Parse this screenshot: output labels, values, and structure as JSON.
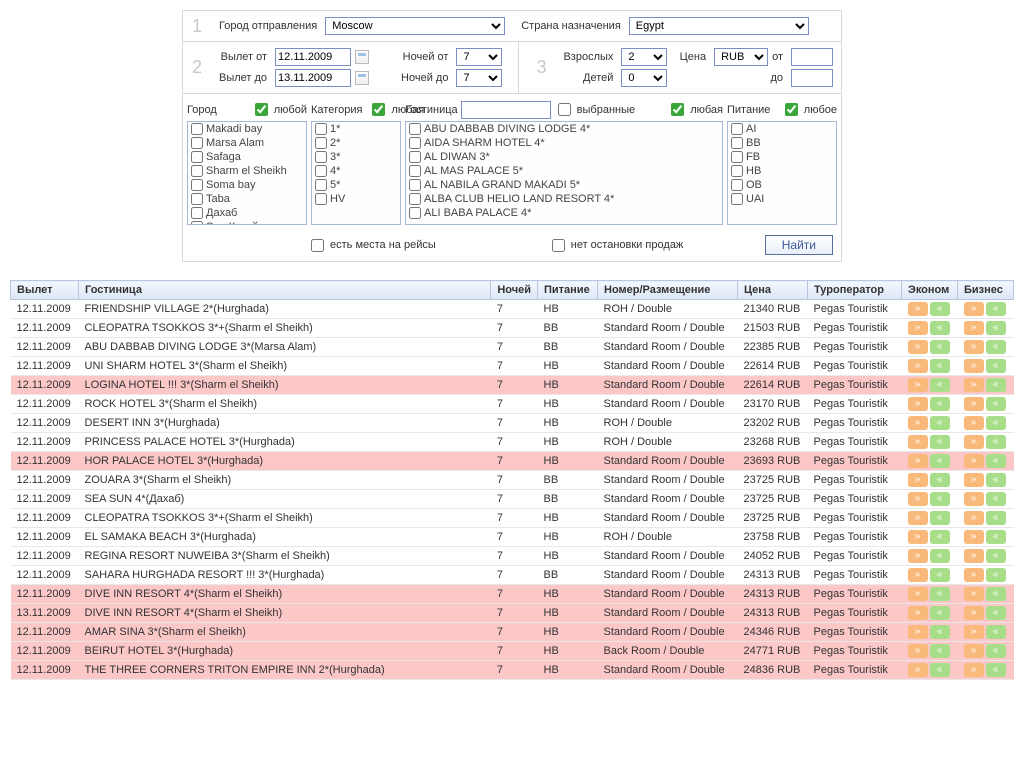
{
  "step1": {
    "num": "1",
    "label_city": "Город отправления",
    "city": "Moscow",
    "label_country": "Страна назначения",
    "country": "Egypt"
  },
  "step2": {
    "num": "2",
    "label_dep_from": "Вылет от",
    "dep_from": "12.11.2009",
    "label_dep_to": "Вылет до",
    "dep_to": "13.11.2009",
    "label_nights_from": "Ночей от",
    "nights_from": "7",
    "label_nights_to": "Ночей до",
    "nights_to": "7"
  },
  "step3": {
    "num": "3",
    "label_adults": "Взрослых",
    "adults": "2",
    "label_children": "Детей",
    "children": "0",
    "label_price": "Цена",
    "currency": "RUB",
    "label_from": "от",
    "label_to": "до"
  },
  "filters": {
    "city": {
      "label": "Город",
      "any": "любой",
      "items": [
        "Makadi bay",
        "Marsa Alam",
        "Safaga",
        "Sharm el Sheikh",
        "Soma bay",
        "Taba",
        "Дахаб",
        "Эль Кусейр"
      ]
    },
    "category": {
      "label": "Категория",
      "any": "любая",
      "items": [
        "1*",
        "2*",
        "3*",
        "4*",
        "5*",
        "HV"
      ]
    },
    "hotel": {
      "label": "Гостиница",
      "selected": "выбранные",
      "any": "любая",
      "items": [
        "ABU DABBAB DIVING LODGE 4*",
        "AIDA SHARM HOTEL 4*",
        "AL DIWAN 3*",
        "AL MAS PALACE 5*",
        "AL NABILA GRAND MAKADI 5*",
        "ALBA CLUB HELIO LAND RESORT 4*",
        "ALI BABA PALACE 4*"
      ]
    },
    "meal": {
      "label": "Питание",
      "any": "любое",
      "items": [
        "AI",
        "BB",
        "FB",
        "HB",
        "OB",
        "UAI"
      ]
    }
  },
  "bottom": {
    "seats": "есть места на рейсы",
    "stops": "нет остановки продаж",
    "find": "Найти"
  },
  "columns": {
    "dep": "Вылет",
    "hotel": "Гостиница",
    "nights": "Ночей",
    "meal": "Питание",
    "room": "Номер/Размещение",
    "price": "Цена",
    "operator": "Туроператор",
    "econom": "Эконом",
    "business": "Бизнес"
  },
  "rows": [
    {
      "d": "12.11.2009",
      "h": "FRIENDSHIP VILLAGE 2*(Hurghada)",
      "n": "7",
      "m": "HB",
      "r": "ROH / Double",
      "p": "21340 RUB",
      "o": "Pegas Touristik",
      "hl": false
    },
    {
      "d": "12.11.2009",
      "h": "CLEOPATRA TSOKKOS 3*+(Sharm el Sheikh)",
      "n": "7",
      "m": "BB",
      "r": "Standard Room / Double",
      "p": "21503 RUB",
      "o": "Pegas Touristik",
      "hl": false
    },
    {
      "d": "12.11.2009",
      "h": "ABU DABBAB DIVING LODGE 3*(Marsa Alam)",
      "n": "7",
      "m": "BB",
      "r": "Standard Room / Double",
      "p": "22385 RUB",
      "o": "Pegas Touristik",
      "hl": false
    },
    {
      "d": "12.11.2009",
      "h": "UNI SHARM HOTEL 3*(Sharm el Sheikh)",
      "n": "7",
      "m": "HB",
      "r": "Standard Room / Double",
      "p": "22614 RUB",
      "o": "Pegas Touristik",
      "hl": false
    },
    {
      "d": "12.11.2009",
      "h": "LOGINA HOTEL !!! 3*(Sharm el Sheikh)",
      "n": "7",
      "m": "HB",
      "r": "Standard Room / Double",
      "p": "22614 RUB",
      "o": "Pegas Touristik",
      "hl": true
    },
    {
      "d": "12.11.2009",
      "h": "ROCK HOTEL 3*(Sharm el Sheikh)",
      "n": "7",
      "m": "HB",
      "r": "Standard Room / Double",
      "p": "23170 RUB",
      "o": "Pegas Touristik",
      "hl": false
    },
    {
      "d": "12.11.2009",
      "h": "DESERT INN 3*(Hurghada)",
      "n": "7",
      "m": "HB",
      "r": "ROH / Double",
      "p": "23202 RUB",
      "o": "Pegas Touristik",
      "hl": false
    },
    {
      "d": "12.11.2009",
      "h": "PRINCESS PALACE HOTEL 3*(Hurghada)",
      "n": "7",
      "m": "HB",
      "r": "ROH / Double",
      "p": "23268 RUB",
      "o": "Pegas Touristik",
      "hl": false
    },
    {
      "d": "12.11.2009",
      "h": "HOR PALACE HOTEL 3*(Hurghada)",
      "n": "7",
      "m": "HB",
      "r": "Standard Room / Double",
      "p": "23693 RUB",
      "o": "Pegas Touristik",
      "hl": true
    },
    {
      "d": "12.11.2009",
      "h": "ZOUARA 3*(Sharm el Sheikh)",
      "n": "7",
      "m": "BB",
      "r": "Standard Room / Double",
      "p": "23725 RUB",
      "o": "Pegas Touristik",
      "hl": false
    },
    {
      "d": "12.11.2009",
      "h": "SEA SUN 4*(Дахаб)",
      "n": "7",
      "m": "BB",
      "r": "Standard Room / Double",
      "p": "23725 RUB",
      "o": "Pegas Touristik",
      "hl": false
    },
    {
      "d": "12.11.2009",
      "h": "CLEOPATRA TSOKKOS 3*+(Sharm el Sheikh)",
      "n": "7",
      "m": "HB",
      "r": "Standard Room / Double",
      "p": "23725 RUB",
      "o": "Pegas Touristik",
      "hl": false
    },
    {
      "d": "12.11.2009",
      "h": "EL SAMAKA BEACH 3*(Hurghada)",
      "n": "7",
      "m": "HB",
      "r": "ROH / Double",
      "p": "23758 RUB",
      "o": "Pegas Touristik",
      "hl": false
    },
    {
      "d": "12.11.2009",
      "h": "REGINA RESORT NUWEIBA 3*(Sharm el Sheikh)",
      "n": "7",
      "m": "HB",
      "r": "Standard Room / Double",
      "p": "24052 RUB",
      "o": "Pegas Touristik",
      "hl": false
    },
    {
      "d": "12.11.2009",
      "h": "SAHARA HURGHADA RESORT !!! 3*(Hurghada)",
      "n": "7",
      "m": "BB",
      "r": "Standard Room / Double",
      "p": "24313 RUB",
      "o": "Pegas Touristik",
      "hl": false
    },
    {
      "d": "12.11.2009",
      "h": "DIVE INN RESORT 4*(Sharm el Sheikh)",
      "n": "7",
      "m": "HB",
      "r": "Standard Room / Double",
      "p": "24313 RUB",
      "o": "Pegas Touristik",
      "hl": true
    },
    {
      "d": "13.11.2009",
      "h": "DIVE INN RESORT 4*(Sharm el Sheikh)",
      "n": "7",
      "m": "HB",
      "r": "Standard Room / Double",
      "p": "24313 RUB",
      "o": "Pegas Touristik",
      "hl": true
    },
    {
      "d": "12.11.2009",
      "h": "AMAR SINA 3*(Sharm el Sheikh)",
      "n": "7",
      "m": "HB",
      "r": "Standard Room / Double",
      "p": "24346 RUB",
      "o": "Pegas Touristik",
      "hl": true
    },
    {
      "d": "12.11.2009",
      "h": "BEIRUT HOTEL 3*(Hurghada)",
      "n": "7",
      "m": "HB",
      "r": "Back Room / Double",
      "p": "24771 RUB",
      "o": "Pegas Touristik",
      "hl": true
    },
    {
      "d": "12.11.2009",
      "h": "THE THREE CORNERS TRITON EMPIRE INN 2*(Hurghada)",
      "n": "7",
      "m": "HB",
      "r": "Standard Room / Double",
      "p": "24836 RUB",
      "o": "Pegas Touristik",
      "hl": true
    }
  ],
  "pills": {
    "fwd": "»",
    "back": "«"
  }
}
